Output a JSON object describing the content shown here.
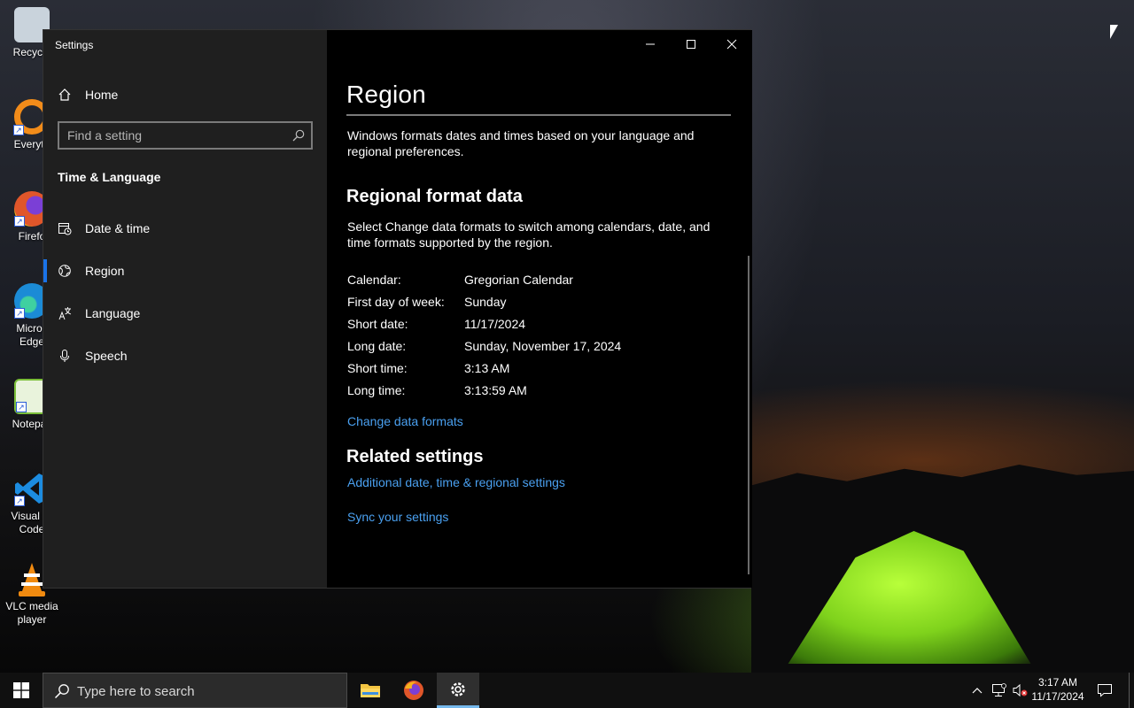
{
  "desktop": {
    "icons": [
      {
        "label": "Recycle",
        "color": "#c9d3dc"
      },
      {
        "label": "Everyth",
        "color": "#f28c1a"
      },
      {
        "label": "Firefo",
        "color": "#e0562a"
      },
      {
        "label": "Micros Edge",
        "color": "#1b8bd6"
      },
      {
        "label": "Notepac",
        "color": "#7bbf3a"
      },
      {
        "label": "Visual St Code",
        "color": "#1c8ce0"
      },
      {
        "label": "VLC media player",
        "color": "#f08a10"
      }
    ]
  },
  "window": {
    "title": "Settings",
    "controls": {
      "minimize": "minimize-icon",
      "maximize": "maximize-icon",
      "close": "close-icon"
    }
  },
  "sidebar": {
    "home_label": "Home",
    "search_placeholder": "Find a setting",
    "section_title": "Time & Language",
    "items": [
      {
        "label": "Date & time",
        "icon": "date-time-icon",
        "selected": false
      },
      {
        "label": "Region",
        "icon": "globe-icon",
        "selected": true
      },
      {
        "label": "Language",
        "icon": "language-icon",
        "selected": false
      },
      {
        "label": "Speech",
        "icon": "microphone-icon",
        "selected": false
      }
    ]
  },
  "main": {
    "title": "Region",
    "intro": "Windows formats dates and times based on your language and regional preferences.",
    "regional_heading": "Regional format data",
    "regional_desc": "Select Change data formats to switch among calendars, date, and time formats supported by the region.",
    "formats": [
      {
        "key": "Calendar:",
        "value": "Gregorian Calendar"
      },
      {
        "key": "First day of week:",
        "value": "Sunday"
      },
      {
        "key": "Short date:",
        "value": "11/17/2024"
      },
      {
        "key": "Long date:",
        "value": "Sunday, November 17, 2024"
      },
      {
        "key": "Short time:",
        "value": "3:13 AM"
      },
      {
        "key": "Long time:",
        "value": "3:13:59 AM"
      }
    ],
    "change_link": "Change data formats",
    "related_heading": "Related settings",
    "related_links": [
      "Additional date, time & regional settings",
      "Sync your settings"
    ],
    "link_color": "#4aa0f0"
  },
  "taskbar": {
    "search_placeholder": "Type here to search",
    "pinned": [
      "file-explorer-icon",
      "firefox-icon",
      "settings-icon"
    ],
    "clock_time": "3:17 AM",
    "clock_date": "11/17/2024",
    "accent": "#76b9ed"
  }
}
